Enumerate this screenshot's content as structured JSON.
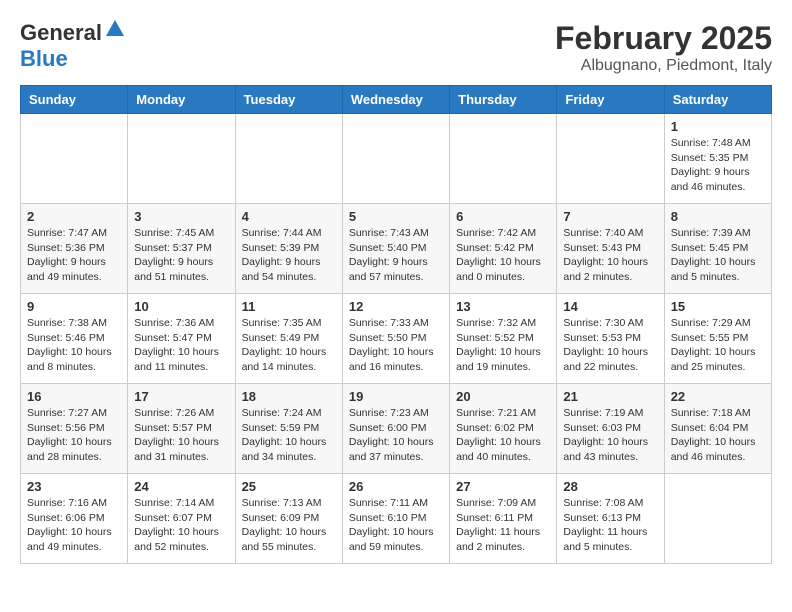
{
  "header": {
    "logo_line1": "General",
    "logo_line2": "Blue",
    "title": "February 2025",
    "subtitle": "Albugnano, Piedmont, Italy"
  },
  "weekdays": [
    "Sunday",
    "Monday",
    "Tuesday",
    "Wednesday",
    "Thursday",
    "Friday",
    "Saturday"
  ],
  "weeks": [
    [
      {
        "day": "",
        "content": ""
      },
      {
        "day": "",
        "content": ""
      },
      {
        "day": "",
        "content": ""
      },
      {
        "day": "",
        "content": ""
      },
      {
        "day": "",
        "content": ""
      },
      {
        "day": "",
        "content": ""
      },
      {
        "day": "1",
        "content": "Sunrise: 7:48 AM\nSunset: 5:35 PM\nDaylight: 9 hours and 46 minutes."
      }
    ],
    [
      {
        "day": "2",
        "content": "Sunrise: 7:47 AM\nSunset: 5:36 PM\nDaylight: 9 hours and 49 minutes."
      },
      {
        "day": "3",
        "content": "Sunrise: 7:45 AM\nSunset: 5:37 PM\nDaylight: 9 hours and 51 minutes."
      },
      {
        "day": "4",
        "content": "Sunrise: 7:44 AM\nSunset: 5:39 PM\nDaylight: 9 hours and 54 minutes."
      },
      {
        "day": "5",
        "content": "Sunrise: 7:43 AM\nSunset: 5:40 PM\nDaylight: 9 hours and 57 minutes."
      },
      {
        "day": "6",
        "content": "Sunrise: 7:42 AM\nSunset: 5:42 PM\nDaylight: 10 hours and 0 minutes."
      },
      {
        "day": "7",
        "content": "Sunrise: 7:40 AM\nSunset: 5:43 PM\nDaylight: 10 hours and 2 minutes."
      },
      {
        "day": "8",
        "content": "Sunrise: 7:39 AM\nSunset: 5:45 PM\nDaylight: 10 hours and 5 minutes."
      }
    ],
    [
      {
        "day": "9",
        "content": "Sunrise: 7:38 AM\nSunset: 5:46 PM\nDaylight: 10 hours and 8 minutes."
      },
      {
        "day": "10",
        "content": "Sunrise: 7:36 AM\nSunset: 5:47 PM\nDaylight: 10 hours and 11 minutes."
      },
      {
        "day": "11",
        "content": "Sunrise: 7:35 AM\nSunset: 5:49 PM\nDaylight: 10 hours and 14 minutes."
      },
      {
        "day": "12",
        "content": "Sunrise: 7:33 AM\nSunset: 5:50 PM\nDaylight: 10 hours and 16 minutes."
      },
      {
        "day": "13",
        "content": "Sunrise: 7:32 AM\nSunset: 5:52 PM\nDaylight: 10 hours and 19 minutes."
      },
      {
        "day": "14",
        "content": "Sunrise: 7:30 AM\nSunset: 5:53 PM\nDaylight: 10 hours and 22 minutes."
      },
      {
        "day": "15",
        "content": "Sunrise: 7:29 AM\nSunset: 5:55 PM\nDaylight: 10 hours and 25 minutes."
      }
    ],
    [
      {
        "day": "16",
        "content": "Sunrise: 7:27 AM\nSunset: 5:56 PM\nDaylight: 10 hours and 28 minutes."
      },
      {
        "day": "17",
        "content": "Sunrise: 7:26 AM\nSunset: 5:57 PM\nDaylight: 10 hours and 31 minutes."
      },
      {
        "day": "18",
        "content": "Sunrise: 7:24 AM\nSunset: 5:59 PM\nDaylight: 10 hours and 34 minutes."
      },
      {
        "day": "19",
        "content": "Sunrise: 7:23 AM\nSunset: 6:00 PM\nDaylight: 10 hours and 37 minutes."
      },
      {
        "day": "20",
        "content": "Sunrise: 7:21 AM\nSunset: 6:02 PM\nDaylight: 10 hours and 40 minutes."
      },
      {
        "day": "21",
        "content": "Sunrise: 7:19 AM\nSunset: 6:03 PM\nDaylight: 10 hours and 43 minutes."
      },
      {
        "day": "22",
        "content": "Sunrise: 7:18 AM\nSunset: 6:04 PM\nDaylight: 10 hours and 46 minutes."
      }
    ],
    [
      {
        "day": "23",
        "content": "Sunrise: 7:16 AM\nSunset: 6:06 PM\nDaylight: 10 hours and 49 minutes."
      },
      {
        "day": "24",
        "content": "Sunrise: 7:14 AM\nSunset: 6:07 PM\nDaylight: 10 hours and 52 minutes."
      },
      {
        "day": "25",
        "content": "Sunrise: 7:13 AM\nSunset: 6:09 PM\nDaylight: 10 hours and 55 minutes."
      },
      {
        "day": "26",
        "content": "Sunrise: 7:11 AM\nSunset: 6:10 PM\nDaylight: 10 hours and 59 minutes."
      },
      {
        "day": "27",
        "content": "Sunrise: 7:09 AM\nSunset: 6:11 PM\nDaylight: 11 hours and 2 minutes."
      },
      {
        "day": "28",
        "content": "Sunrise: 7:08 AM\nSunset: 6:13 PM\nDaylight: 11 hours and 5 minutes."
      },
      {
        "day": "",
        "content": ""
      }
    ]
  ]
}
